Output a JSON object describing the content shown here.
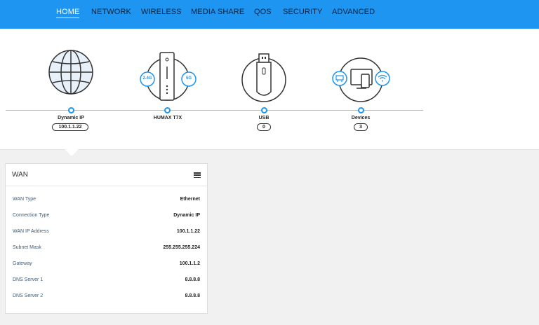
{
  "nav": {
    "items": [
      {
        "label": "HOME",
        "active": true
      },
      {
        "label": "NETWORK",
        "active": false
      },
      {
        "label": "WIRELESS",
        "active": false
      },
      {
        "label": "MEDIA SHARE",
        "active": false
      },
      {
        "label": "QOS",
        "active": false
      },
      {
        "label": "SECURITY",
        "active": false
      },
      {
        "label": "ADVANCED",
        "active": false
      }
    ]
  },
  "diagram": {
    "internet": {
      "label": "Dynamic IP",
      "value": "100.1.1.22",
      "icon": "globe-icon"
    },
    "router": {
      "label": "HUMAX T7X",
      "band_24": "2.4G",
      "band_5": "5G",
      "icon": "router-icon"
    },
    "usb": {
      "label": "USB",
      "value": "0",
      "icon": "usb-drive-icon"
    },
    "devices": {
      "label": "Devices",
      "value": "3",
      "icon": "devices-icon"
    }
  },
  "wan": {
    "title": "WAN",
    "rows": [
      {
        "label": "WAN Type",
        "value": "Ethernet"
      },
      {
        "label": "Connection Type",
        "value": "Dynamic IP"
      },
      {
        "label": "WAN IP Address",
        "value": "100.1.1.22"
      },
      {
        "label": "Subnet Mask",
        "value": "255.255.255.224"
      },
      {
        "label": "Gateway",
        "value": "100.1.1.2"
      },
      {
        "label": "DNS Server 1",
        "value": "8.8.8.8"
      },
      {
        "label": "DNS Server 2",
        "value": "8.8.8.8"
      }
    ]
  },
  "colors": {
    "accent": "#1e95f1",
    "nav_text": "#0a1f33",
    "icon_fill": "#e8f1f9"
  }
}
